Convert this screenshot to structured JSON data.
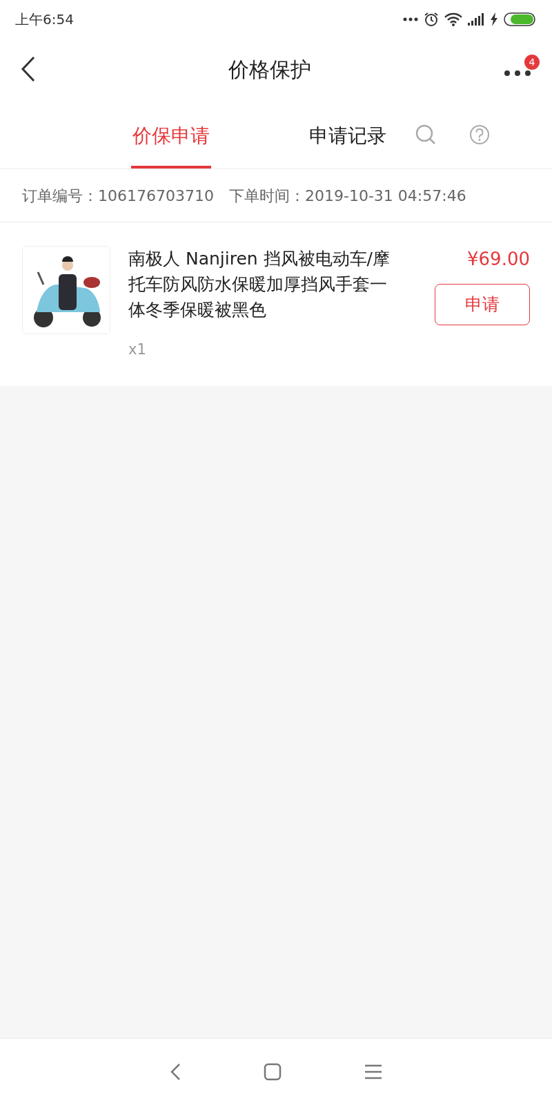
{
  "status_bar": {
    "time": "上午6:54"
  },
  "header": {
    "title": "价格保护",
    "badge": "4"
  },
  "tabs": [
    {
      "label": "价保申请",
      "selected": true
    },
    {
      "label": "申请记录",
      "selected": false
    }
  ],
  "order": {
    "number_label": "订单编号：",
    "number": "106176703710",
    "time_label": "下单时间：",
    "time": "2019-10-31 04:57:46"
  },
  "items": [
    {
      "title": "南极人 Nanjiren 挡风被电动车/摩托车防风防水保暖加厚挡风手套一体冬季保暖被黑色",
      "quantity": "x1",
      "price": "¥69.00",
      "button": "申请"
    }
  ]
}
